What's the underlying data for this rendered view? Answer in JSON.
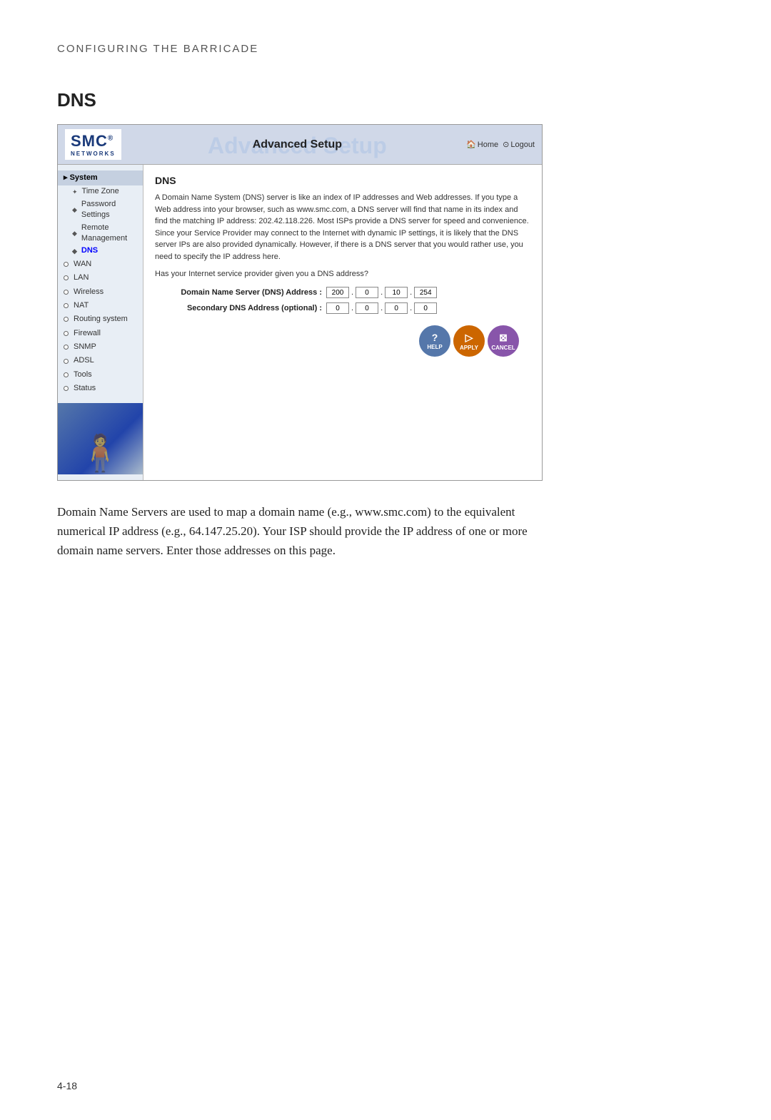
{
  "page": {
    "header": "Configuring the Barricade",
    "page_number": "4-18",
    "section": "DNS"
  },
  "router_ui": {
    "logo": {
      "brand": "SMC",
      "trademark": "®",
      "sub": "Networks"
    },
    "header": {
      "bg_title": "Advanced Setup",
      "fg_title": "Advanced Setup",
      "nav": {
        "home_icon": "🏠",
        "home_label": "Home",
        "logout_icon": "⊙",
        "logout_label": "Logout"
      }
    },
    "sidebar": {
      "items": [
        {
          "id": "system",
          "label": "System",
          "type": "section-header"
        },
        {
          "id": "timezone",
          "label": "Time Zone",
          "type": "sub",
          "bullet": "star"
        },
        {
          "id": "password",
          "label": "Password Settings",
          "type": "sub",
          "bullet": "leaf"
        },
        {
          "id": "remote",
          "label": "Remote Management",
          "type": "sub",
          "bullet": "leaf"
        },
        {
          "id": "dns-nav",
          "label": "DNS",
          "type": "sub",
          "bullet": "leaf",
          "active": true
        },
        {
          "id": "wan",
          "label": "WAN",
          "type": "main"
        },
        {
          "id": "lan",
          "label": "LAN",
          "type": "main"
        },
        {
          "id": "wireless",
          "label": "Wireless",
          "type": "main"
        },
        {
          "id": "nat",
          "label": "NAT",
          "type": "main"
        },
        {
          "id": "routing",
          "label": "Routing system",
          "type": "main"
        },
        {
          "id": "firewall",
          "label": "Firewall",
          "type": "main"
        },
        {
          "id": "snmp",
          "label": "SNMP",
          "type": "main"
        },
        {
          "id": "adsl",
          "label": "ADSL",
          "type": "main"
        },
        {
          "id": "tools",
          "label": "Tools",
          "type": "main"
        },
        {
          "id": "status",
          "label": "Status",
          "type": "main"
        }
      ]
    },
    "content": {
      "title": "DNS",
      "description": "A Domain Name System (DNS) server is like an index of IP addresses and Web addresses. If you type a Web address into your browser, such as www.smc.com, a DNS server will find that name in its index and find the matching IP address: 202.42.118.226. Most ISPs provide a DNS server for speed and convenience. Since your Service Provider may connect to the Internet with dynamic IP settings, it is likely that the DNS server IPs are also provided dynamically. However, if there is a DNS server that you would rather use, you need to specify the IP address here.",
      "question": "Has your Internet service provider given you a DNS address?",
      "dns_label": "Domain Name Server (DNS) Address :",
      "dns_fields": [
        "200",
        "0",
        "10",
        "254"
      ],
      "secondary_label": "Secondary DNS Address (optional) :",
      "secondary_fields": [
        "0",
        "0",
        "0",
        "0"
      ]
    },
    "buttons": {
      "help": "HELP",
      "apply": "APPLY",
      "cancel": "CANCEL"
    }
  },
  "body_text": "Domain Name Servers are used to map a domain name (e.g., www.smc.com) to the equivalent numerical IP address (e.g., 64.147.25.20). Your ISP should provide the IP address of one or more domain name servers. Enter those addresses on this page."
}
